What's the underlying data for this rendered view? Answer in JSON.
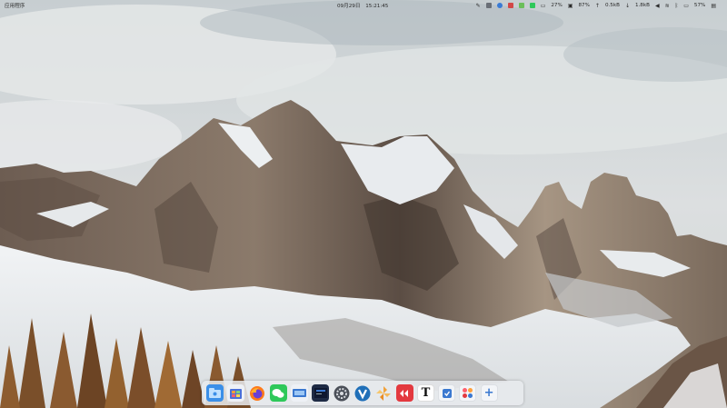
{
  "topbar": {
    "launcher_label": "应用程序",
    "date": "09月29日",
    "time": "15:21:45",
    "tray": {
      "battery_percent": "27%",
      "cpu_label": "87%",
      "upload": "0.5kB",
      "download": "1.8kB",
      "charge_percent": "57%"
    }
  },
  "dock": {
    "items": [
      {
        "name": "file-manager",
        "color": "#3b8fe8"
      },
      {
        "name": "app-store",
        "color": "#4a6fd8"
      },
      {
        "name": "firefox",
        "color": "#ff7a1a"
      },
      {
        "name": "wechat",
        "color": "#2ec85a"
      },
      {
        "name": "remote-desktop",
        "color": "#3a78d0"
      },
      {
        "name": "terminal",
        "color": "#1e2a44"
      },
      {
        "name": "settings",
        "color": "#4a4f58"
      },
      {
        "name": "v-app",
        "color": "#1f6fb8"
      },
      {
        "name": "pinwheel-app",
        "color": "#f1a23a"
      },
      {
        "name": "video-app",
        "color": "#e3393f"
      },
      {
        "name": "typora",
        "color": "#ffffff"
      },
      {
        "name": "installer",
        "color": "#f2f4f7"
      },
      {
        "name": "app-grid",
        "color": "#f3f5f8"
      },
      {
        "name": "add",
        "color": "#f3f5f8"
      }
    ]
  },
  "colors": {
    "sky": "#b9c2c6",
    "rock": "#8a7868",
    "snow": "#eef0f2"
  }
}
